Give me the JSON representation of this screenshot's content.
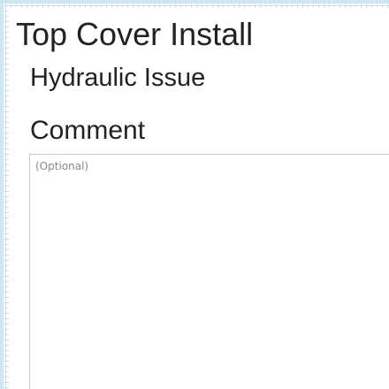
{
  "header": {
    "title": "Top Cover Install"
  },
  "issue": {
    "title": "Hydraulic Issue"
  },
  "comment": {
    "label": "Comment",
    "placeholder": "(Optional)",
    "value": ""
  },
  "colors": {
    "background": "#ffffff",
    "grid": "#a0cde6",
    "text": "#222222",
    "field_border": "#c8c8c8",
    "placeholder": "#8a8a8a"
  }
}
